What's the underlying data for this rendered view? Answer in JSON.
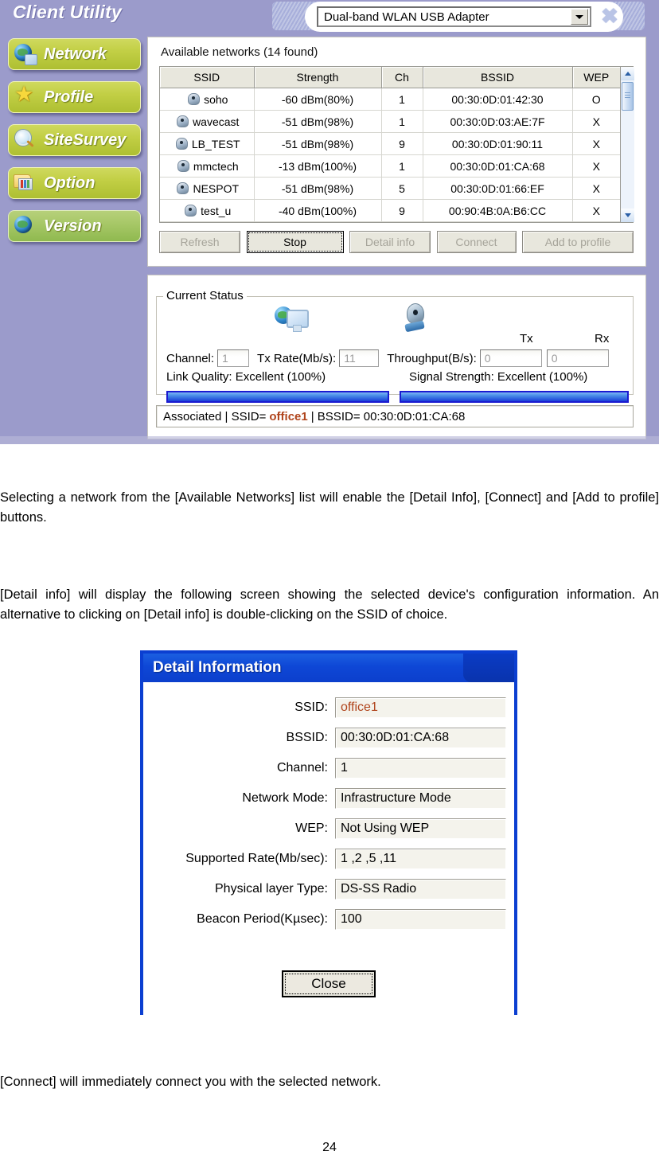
{
  "app": {
    "title": "Client Utility",
    "adapter": {
      "selected": "Dual-band WLAN USB Adapter",
      "dropdown_icon": "chevron-down-icon"
    },
    "close_label": "✖"
  },
  "sidebar": {
    "items": [
      {
        "label": "Network",
        "icon": "globe-monitor-icon",
        "style": "olive"
      },
      {
        "label": "Profile",
        "icon": "star-icon",
        "style": "olive"
      },
      {
        "label": "SiteSurvey",
        "icon": "magnifier-icon",
        "style": "olive"
      },
      {
        "label": "Option",
        "icon": "folder-books-icon",
        "style": "olive"
      },
      {
        "label": "Version",
        "icon": "globe-icon",
        "style": "green"
      }
    ]
  },
  "networks": {
    "caption": "Available networks  (14 found)",
    "columns": [
      "SSID",
      "Strength",
      "Ch",
      "BSSID",
      "WEP"
    ],
    "rows": [
      {
        "ssid": "soho",
        "strength": "-60 dBm(80%)",
        "ch": "1",
        "bssid": "00:30:0D:01:42:30",
        "wep": "O"
      },
      {
        "ssid": "wavecast",
        "strength": "-51 dBm(98%)",
        "ch": "1",
        "bssid": "00:30:0D:03:AE:7F",
        "wep": "X"
      },
      {
        "ssid": "LB_TEST",
        "strength": "-51 dBm(98%)",
        "ch": "9",
        "bssid": "00:30:0D:01:90:11",
        "wep": "X"
      },
      {
        "ssid": "mmctech",
        "strength": "-13 dBm(100%)",
        "ch": "1",
        "bssid": "00:30:0D:01:CA:68",
        "wep": "X"
      },
      {
        "ssid": "NESPOT",
        "strength": "-51 dBm(98%)",
        "ch": "5",
        "bssid": "00:30:0D:01:66:EF",
        "wep": "X"
      },
      {
        "ssid": "test_u",
        "strength": "-40 dBm(100%)",
        "ch": "9",
        "bssid": "00:90:4B:0A:B6:CC",
        "wep": "X"
      }
    ],
    "buttons": {
      "refresh": "Refresh",
      "stop": "Stop",
      "detail_info": "Detail info",
      "connect": "Connect",
      "add_to_profile": "Add to profile"
    }
  },
  "status": {
    "legend": "Current Status",
    "channel_label": "Channel:",
    "channel_value": "1",
    "txrate_label": "Tx Rate(Mb/s):",
    "txrate_value": "11",
    "throughput_label": "Throughput(B/s):",
    "tx_header": "Tx",
    "rx_header": "Rx",
    "tx_value": "0",
    "rx_value": "0",
    "link_quality": "Link Quality:  Excellent (100%)",
    "signal_strength": "Signal Strength:  Excellent (100%)",
    "link_quality_percent": 100,
    "signal_strength_percent": 100,
    "assoc_prefix": "Associated | SSID=",
    "assoc_ssid": "office1",
    "assoc_suffix": "| BSSID= 00:30:0D:01:CA:68"
  },
  "document": {
    "para1": "Selecting a network from the [Available Networks] list will enable the [Detail Info], [Connect] and [Add to profile] buttons.",
    "para2": "[Detail info] will display the following screen showing the selected device's configuration information. An alternative to clicking on [Detail info] is double-clicking on the SSID of choice.",
    "para3": "[Connect] will immediately connect you with the selected network.",
    "page_number": "24"
  },
  "detail_dialog": {
    "title": "Detail Information",
    "fields": [
      {
        "label": "SSID:",
        "value": "office1",
        "highlight": true
      },
      {
        "label": "BSSID:",
        "value": "00:30:0D:01:CA:68",
        "highlight": false
      },
      {
        "label": "Channel:",
        "value": "1",
        "highlight": false
      },
      {
        "label": "Network Mode:",
        "value": "Infrastructure Mode",
        "highlight": false
      },
      {
        "label": "WEP:",
        "value": "Not Using WEP",
        "highlight": false
      },
      {
        "label": "Supported Rate(Mb/sec):",
        "value": "1 ,2 ,5 ,11",
        "highlight": false
      },
      {
        "label": "Physical layer Type:",
        "value": "DS-SS Radio",
        "highlight": false
      },
      {
        "label": "Beacon Period(Kµsec):",
        "value": "100",
        "highlight": false
      }
    ],
    "close_label": "Close"
  },
  "colors": {
    "app_background": "#9b9bcb",
    "sidebar_button_olive": "#c2cf45",
    "sidebar_button_green": "#a6c766",
    "dialog_titlebar": "#0e47d6",
    "progress_bar": "#1a3fd8",
    "ssid_highlight": "#b0441c",
    "table_header": "#e8e7dd"
  }
}
